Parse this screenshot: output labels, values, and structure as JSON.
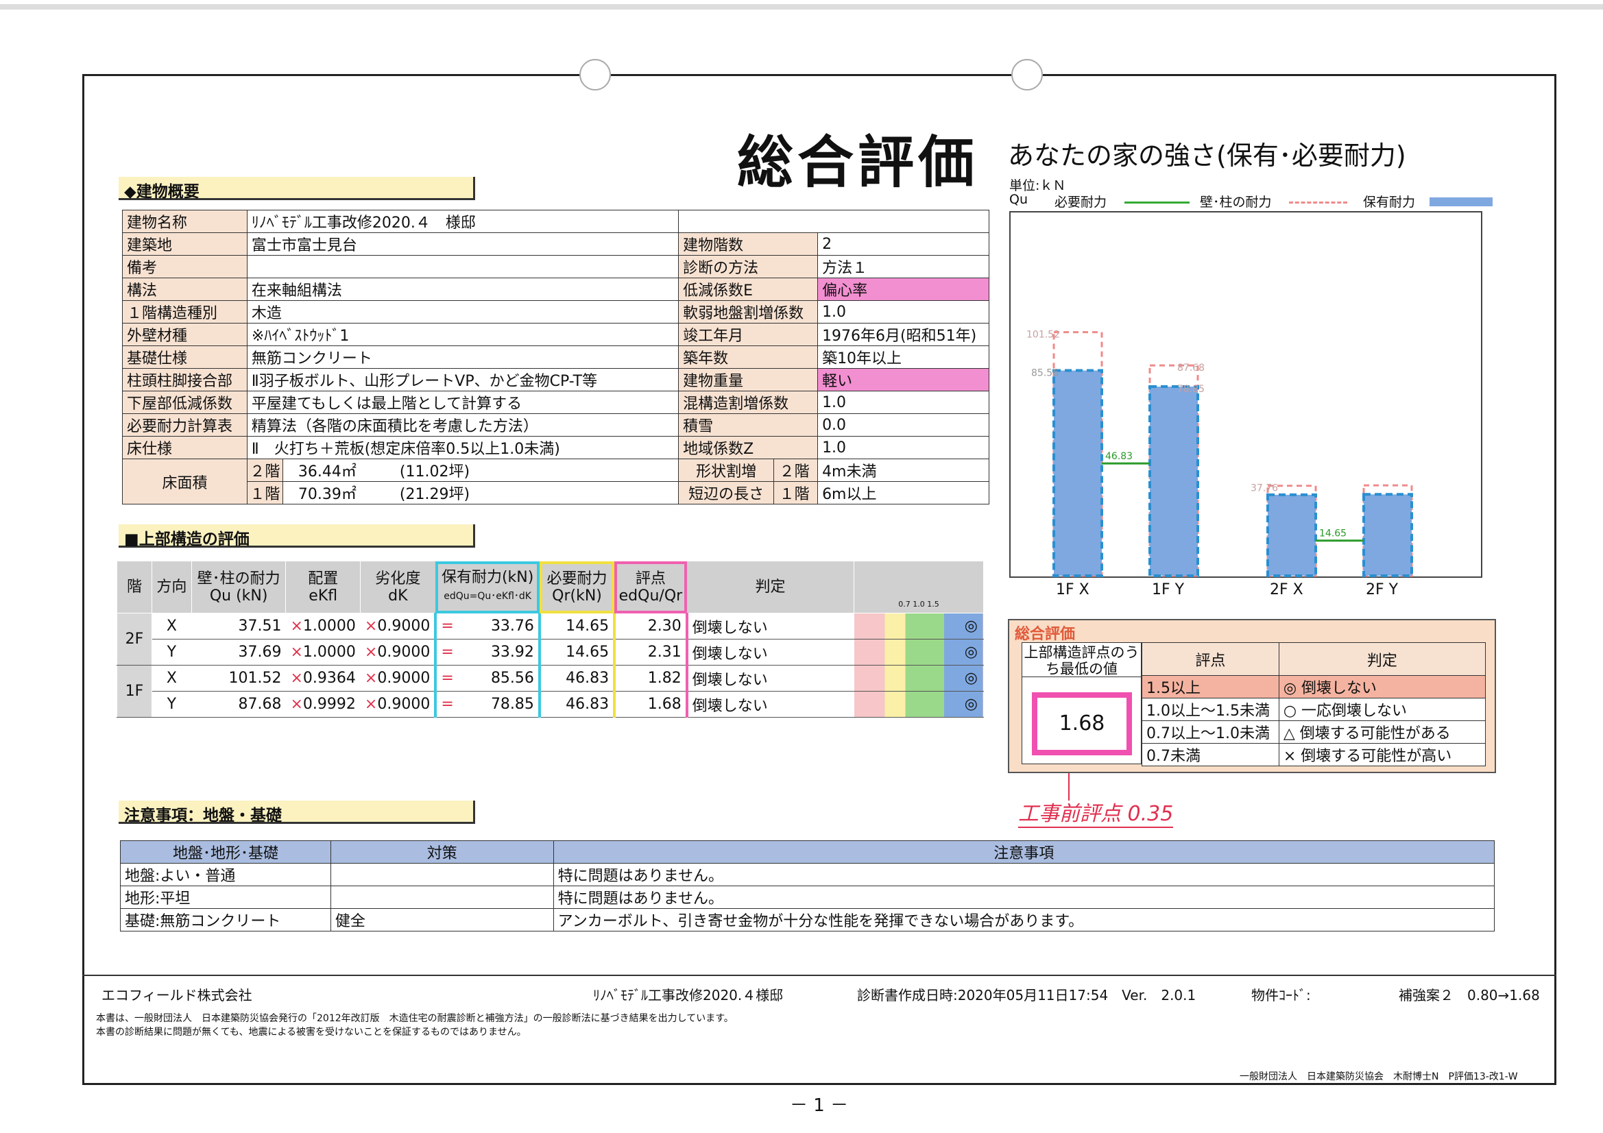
{
  "title": "総合評価",
  "subtitle": "あなたの家の強さ(保有･必要耐力)",
  "unit": "単位:ｋＮ",
  "legend": {
    "qu": "Qu",
    "req": "必要耐力",
    "wall": "壁･柱の耐力",
    "hold": "保有耐力"
  },
  "sec1": "◆建物概要",
  "sec2": "■上部構造の評価",
  "sec3": "注意事項：地盤・基礎",
  "overview": {
    "rows": [
      [
        "建物名称",
        "ﾘﾉﾍﾞﾓﾃﾞﾙ工事改修2020.４　様邸",
        "",
        ""
      ],
      [
        "建築地",
        "富士市富士見台",
        "建物階数",
        "2"
      ],
      [
        "備考",
        "",
        "診断の方法",
        "方法１"
      ],
      [
        "構法",
        "在来軸組構法",
        "低減係数E",
        "偏心率"
      ],
      [
        "１階構造種別",
        "木造",
        "軟弱地盤割増係数",
        "1.0"
      ],
      [
        "外壁材種",
        "※ﾊｲﾍﾞｽﾄｳｯﾄﾞ1",
        "竣工年月",
        "1976年6月(昭和51年)"
      ],
      [
        "基礎仕様",
        "無筋コンクリート",
        "築年数",
        "築10年以上"
      ],
      [
        "柱頭柱脚接合部",
        "Ⅱ羽子板ボルト、山形プレートVP、かど金物CP-T等",
        "建物重量",
        "軽い"
      ],
      [
        "下屋部低減係数",
        "平屋建てもしくは最上階として計算する",
        "混構造割増係数",
        "1.0"
      ],
      [
        "必要耐力計算表",
        "精算法（各階の床面積比を考慮した方法）",
        "積雪",
        "0.0"
      ],
      [
        "床仕様",
        "Ⅱ　火打ち＋荒板(想定床倍率0.5以上1.0未満)",
        "地域係数Z",
        "1.0"
      ]
    ],
    "floor_label": "床面積",
    "floor2": {
      "fl": "２階",
      "area": "36.44㎡",
      "tsubo": "(11.02坪)"
    },
    "floor1": {
      "fl": "１階",
      "area": "70.39㎡",
      "tsubo": "(21.29坪)"
    },
    "shape_label": "形状割増",
    "short_label": "短辺の長さ",
    "shape2": {
      "fl": "２階",
      "val": "4m未満"
    },
    "shape1": {
      "fl": "１階",
      "val": "6m以上"
    }
  },
  "eval_table": {
    "headers": [
      "階",
      "方向",
      "壁･柱の耐力",
      "Qu (kN)",
      "配置",
      "eKfl",
      "劣化度",
      "dK",
      "保有耐力(kN)",
      "edQu=Qu･eKfl･dK",
      "必要耐力",
      "Qr(kN)",
      "評点",
      "edQu/Qr",
      "判定"
    ],
    "scale": "0.7 1.0    1.5",
    "rows": [
      {
        "floor": "2F",
        "dir": "X",
        "qu": "37.51",
        "ekfl": "1.0000",
        "dk": "0.9000",
        "edqu": "33.76",
        "qr": "14.65",
        "score": "2.30",
        "judge": "倒壊しない",
        "mark": "◎"
      },
      {
        "floor": "",
        "dir": "Y",
        "qu": "37.69",
        "ekfl": "1.0000",
        "dk": "0.9000",
        "edqu": "33.92",
        "qr": "14.65",
        "score": "2.31",
        "judge": "倒壊しない",
        "mark": "◎"
      },
      {
        "floor": "1F",
        "dir": "X",
        "qu": "101.52",
        "ekfl": "0.9364",
        "dk": "0.9000",
        "edqu": "85.56",
        "qr": "46.83",
        "score": "1.82",
        "judge": "倒壊しない",
        "mark": "◎"
      },
      {
        "floor": "",
        "dir": "Y",
        "qu": "87.68",
        "ekfl": "0.9992",
        "dk": "0.9000",
        "edqu": "78.85",
        "qr": "46.83",
        "score": "1.68",
        "judge": "倒壊しない",
        "mark": "◎"
      }
    ],
    "x": "×",
    "eq": "="
  },
  "chart_data": {
    "type": "bar",
    "categories": [
      "1F X",
      "1F Y",
      "2F X",
      "2F Y"
    ],
    "series": [
      {
        "name": "保有耐力",
        "values": [
          85.56,
          78.85,
          33.76,
          33.92
        ]
      },
      {
        "name": "壁･柱の耐力",
        "values": [
          101.52,
          87.68,
          37.51,
          37.69
        ]
      },
      {
        "name": "必要耐力",
        "values": [
          46.83,
          46.83,
          14.65,
          14.65
        ]
      }
    ],
    "labels": {
      "wall1x": "101.52",
      "hold1x": "85.56",
      "wall1y": "87.68",
      "hold1y": "78.85",
      "wall2x": "37.76",
      "req1": "46.83",
      "req2": "14.65"
    },
    "ylim": [
      0,
      120
    ]
  },
  "summary": {
    "title": "総合評価",
    "min_label": "上部構造評点のうち最低の値",
    "score": "1.68",
    "col_score": "評点",
    "col_judge": "判定",
    "rows": [
      [
        "1.5以上",
        "◎ 倒壊しない"
      ],
      [
        "1.0以上～1.5未満",
        "○ 一応倒壊しない"
      ],
      [
        "0.7以上～1.0未満",
        "△ 倒壊する可能性がある"
      ],
      [
        "0.7未満",
        "× 倒壊する可能性が高い"
      ]
    ],
    "handnote": "工事前評点 0.35"
  },
  "cautions": {
    "headers": [
      "地盤･地形･基礎",
      "対策",
      "注意事項"
    ],
    "rows": [
      [
        "地盤:よい・普通",
        "",
        "特に問題はありません。"
      ],
      [
        "地形:平坦",
        "",
        "特に問題はありません。"
      ],
      [
        "基礎:無筋コンクリート",
        "健全",
        "アンカーボルト、引き寄せ金物が十分な性能を発揮できない場合があります。"
      ]
    ]
  },
  "footer": {
    "company": "エコフィールド株式会社",
    "project": "ﾘﾉﾍﾞﾓﾃﾞﾙ工事改修2020.４様邸",
    "date": "診断書作成日時:2020年05月11日17:54　Ver.　2.0.1",
    "code": "物件ｺｰﾄﾞ:",
    "plan": "補強案２　0.80→1.68",
    "note1": "本書は、一般財団法人　日本建築防災協会発行の「2012年改訂版　木造住宅の耐震診断と補強方法」の一般診断法に基づき結果を出力しています。",
    "note2": "本書の診断結果に問題が無くても、地震による被害を受けないことを保証するものではありません。",
    "publisher": "一般財団法人　日本建築防災協会　木耐博士N　P評価13-改1-W",
    "page": "－ 1 －"
  }
}
